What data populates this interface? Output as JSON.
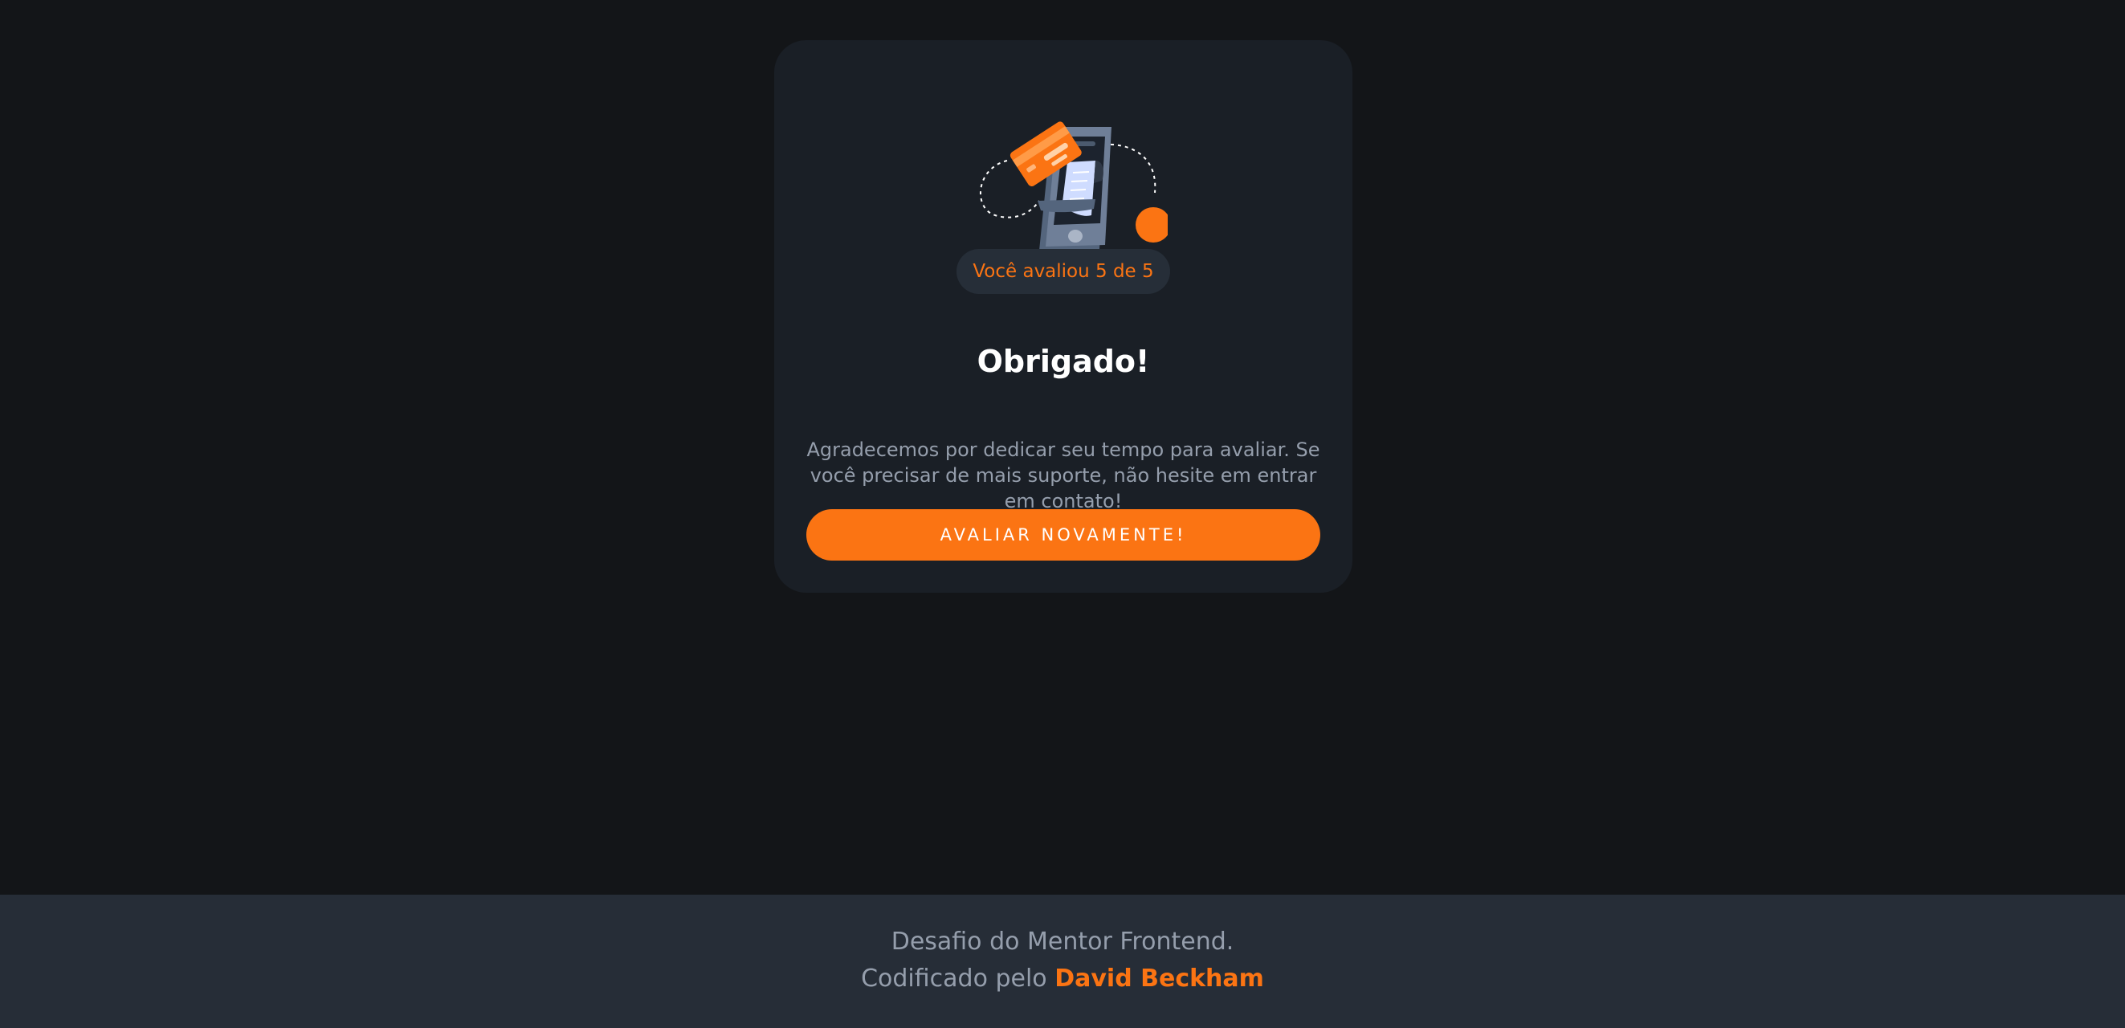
{
  "card": {
    "rating_badge": "Você avaliou 5 de 5",
    "title": "Obrigado!",
    "description": "Agradecemos por dedicar seu tempo para avaliar. Se você precisar de mais suporte, não hesite em entrar em contato!",
    "button_label": "AVALIAR NOVAMENTE!"
  },
  "footer": {
    "line1": "Desafio do Mentor Frontend.",
    "line2_prefix": "Codificado pelo ",
    "author": "David Beckham"
  },
  "colors": {
    "background": "#131518",
    "card": "#1a1f26",
    "accent": "#fb7413",
    "footer": "#262d37",
    "muted_text": "#959eac"
  },
  "icons": [
    "thank-you-illustration"
  ]
}
